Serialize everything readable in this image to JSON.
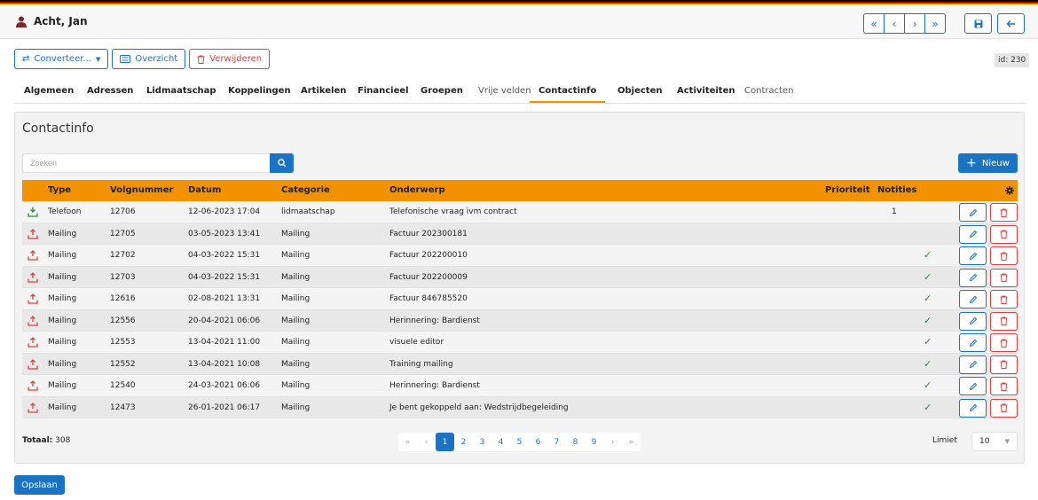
{
  "header": {
    "user_name": "Acht, Jan",
    "nav": {
      "first": "«",
      "prev": "‹",
      "next": "›",
      "last": "»"
    },
    "save_icon": "floppy-disk-icon",
    "back_icon": "arrow-left-icon"
  },
  "actions": {
    "convert_label": "Converteer...",
    "overview_label": "Overzicht",
    "delete_label": "Verwijderen"
  },
  "record_id": "id: 230",
  "tabs": [
    {
      "label": "Algemeen"
    },
    {
      "label": "Adressen"
    },
    {
      "label": "Lidmaatschap"
    },
    {
      "label": "Koppelingen"
    },
    {
      "label": "Artikelen"
    },
    {
      "label": "Financieel"
    },
    {
      "label": "Groepen"
    },
    {
      "label": "Vrije velden"
    },
    {
      "label": "Contactinfo"
    },
    {
      "label": "Objecten"
    },
    {
      "label": "Activiteiten"
    },
    {
      "label": "Contracten"
    }
  ],
  "panel": {
    "title": "Contactinfo",
    "search_placeholder": "Zoeken",
    "new_label": "Nieuw"
  },
  "table": {
    "columns": [
      "Type",
      "Volgnummer",
      "Datum",
      "Categorie",
      "Onderwerp",
      "Prioriteit",
      "Notities"
    ],
    "rows": [
      {
        "type": "Telefoon",
        "nr": "12706",
        "date": "12-06-2023 17:04",
        "cat": "lidmaatschap",
        "subject": "Telefonische vraag ivm contract",
        "notes": "1",
        "check": ""
      },
      {
        "type": "Mailing",
        "nr": "12705",
        "date": "03-05-2023 13:41",
        "cat": "Mailing",
        "subject": "Factuur 202300181",
        "notes": "",
        "check": ""
      },
      {
        "type": "Mailing",
        "nr": "12702",
        "date": "04-03-2022 15:31",
        "cat": "Mailing",
        "subject": "Factuur 202200010",
        "notes": "",
        "check": "✓"
      },
      {
        "type": "Mailing",
        "nr": "12703",
        "date": "04-03-2022 15:31",
        "cat": "Mailing",
        "subject": "Factuur 202200009",
        "notes": "",
        "check": "✓"
      },
      {
        "type": "Mailing",
        "nr": "12616",
        "date": "02-08-2021 13:31",
        "cat": "Mailing",
        "subject": "Factuur 846785520",
        "notes": "",
        "check": "✓"
      },
      {
        "type": "Mailing",
        "nr": "12556",
        "date": "20-04-2021 06:06",
        "cat": "Mailing",
        "subject": "Herinnering: Bardienst",
        "notes": "",
        "check": "✓"
      },
      {
        "type": "Mailing",
        "nr": "12553",
        "date": "13-04-2021 11:00",
        "cat": "Mailing",
        "subject": "visuele editor",
        "notes": "",
        "check": "✓"
      },
      {
        "type": "Mailing",
        "nr": "12552",
        "date": "13-04-2021 10:08",
        "cat": "Mailing",
        "subject": "Training mailing",
        "notes": "",
        "check": "✓"
      },
      {
        "type": "Mailing",
        "nr": "12540",
        "date": "24-03-2021 06:06",
        "cat": "Mailing",
        "subject": "Herinnering: Bardienst",
        "notes": "",
        "check": "✓"
      },
      {
        "type": "Mailing",
        "nr": "12473",
        "date": "26-01-2021 06:17",
        "cat": "Mailing",
        "subject": "Je bent gekoppeld aan: Wedstrijdbegeleiding",
        "notes": "",
        "check": "✓"
      }
    ]
  },
  "footer": {
    "total_label": "Totaal:",
    "total_value": "308",
    "pages": [
      "«",
      "‹",
      "1",
      "2",
      "3",
      "4",
      "5",
      "6",
      "7",
      "8",
      "9",
      "›",
      "»"
    ],
    "active_page": "1",
    "limit_label": "Limiet",
    "limit_value": "10"
  },
  "save_label": "Opslaan",
  "colors": {
    "accent": "#f39200",
    "primary": "#1b73c4",
    "danger": "#d64545"
  }
}
